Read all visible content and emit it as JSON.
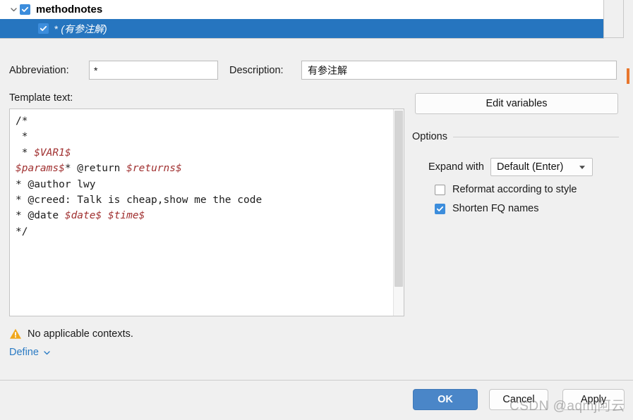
{
  "tree": {
    "root": {
      "label": "methodnotes",
      "checked": true,
      "expanded": true,
      "twisty_icon": "chevron-down-icon",
      "checkbox_icon": "checkmark-icon"
    },
    "child": {
      "abbrev": "*",
      "description": "(有参注解)",
      "checked": true,
      "selected": true,
      "checkbox_icon": "checkmark-icon"
    }
  },
  "form": {
    "abbreviation_label": "Abbreviation:",
    "abbreviation_value": "*",
    "abbreviation_placeholder": "",
    "description_label": "Description:",
    "description_value": "有参注解",
    "description_placeholder": ""
  },
  "template": {
    "label": "Template text:",
    "lines": [
      "/*",
      " *",
      " * $VAR1$",
      "$params$* @return $returns$",
      "* @author lwy",
      "* @creed: Talk is cheap,show me the code",
      "* @date $date$ $time$",
      "*/"
    ],
    "full_text": "/*\n *\n * $VAR1$\n$params$* @return $returns$\n* @author lwy\n* @creed: Talk is cheap,show me the code\n* @date $date$ $time$\n*/",
    "variable_color": "#a03030",
    "scrollbar": "vertical-scrollbar"
  },
  "status": {
    "warning_icon": "warning-triangle-icon",
    "warning_text": "No applicable contexts.",
    "define_link": "Define",
    "define_chevron_icon": "chevron-down-icon",
    "link_color": "#2b7bc4"
  },
  "right_panel": {
    "edit_variables_label": "Edit variables",
    "options_title": "Options",
    "expand_with_label": "Expand with",
    "expand_with_value": "Default (Enter)",
    "expand_caret_icon": "caret-down-icon",
    "checkboxes": [
      {
        "label": "Reformat according to style",
        "checked": false
      },
      {
        "label": "Shorten FQ names",
        "checked": true
      }
    ]
  },
  "footer": {
    "ok_label": "OK",
    "cancel_label": "Cancel",
    "apply_label": "Apply",
    "accent_color": "#4a86c8"
  },
  "watermark": {
    "text": "CSDN @aqmj阿云"
  }
}
